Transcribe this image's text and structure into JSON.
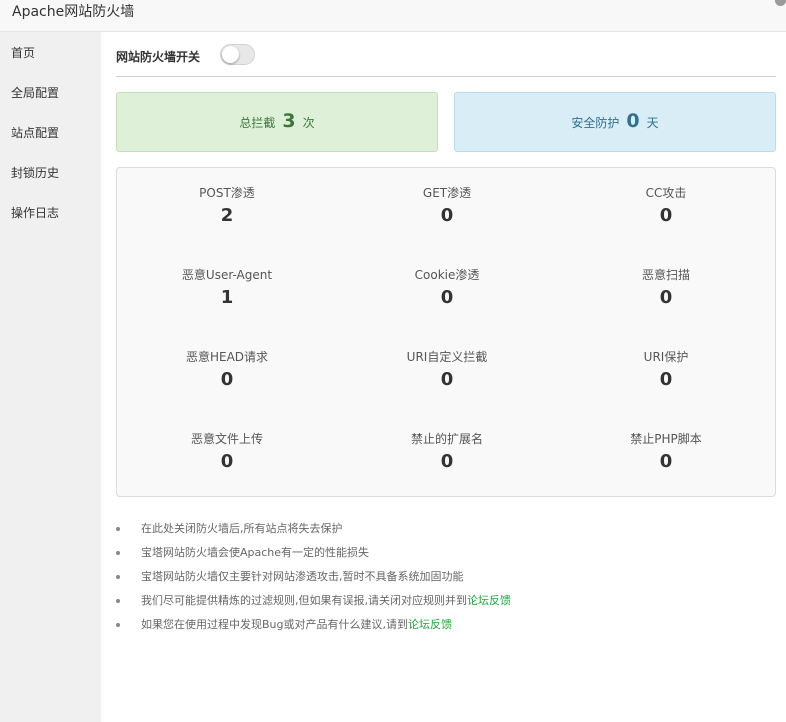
{
  "window": {
    "title": "Apache网站防火墙"
  },
  "sidebar": {
    "items": [
      {
        "label": "首页"
      },
      {
        "label": "全局配置"
      },
      {
        "label": "站点配置"
      },
      {
        "label": "封锁历史"
      },
      {
        "label": "操作日志"
      }
    ]
  },
  "switch": {
    "label": "网站防火墙开关",
    "enabled": false
  },
  "summary": {
    "total_intercept": {
      "label": "总拦截",
      "value": "3",
      "unit": "次"
    },
    "safe_protect": {
      "label": "安全防护",
      "value": "0",
      "unit": "天"
    }
  },
  "stats": [
    {
      "label": "POST渗透",
      "value": "2"
    },
    {
      "label": "GET渗透",
      "value": "0"
    },
    {
      "label": "CC攻击",
      "value": "0"
    },
    {
      "label": "恶意User-Agent",
      "value": "1"
    },
    {
      "label": "Cookie渗透",
      "value": "0"
    },
    {
      "label": "恶意扫描",
      "value": "0"
    },
    {
      "label": "恶意HEAD请求",
      "value": "0"
    },
    {
      "label": "URI自定义拦截",
      "value": "0"
    },
    {
      "label": "URI保护",
      "value": "0"
    },
    {
      "label": "恶意文件上传",
      "value": "0"
    },
    {
      "label": "禁止的扩展名",
      "value": "0"
    },
    {
      "label": "禁止PHP脚本",
      "value": "0"
    }
  ],
  "notes": [
    {
      "text": "在此处关闭防火墙后,所有站点将失去保护"
    },
    {
      "text": "宝塔网站防火墙会使Apache有一定的性能损失"
    },
    {
      "text": "宝塔网站防火墙仅主要针对网站渗透攻击,暂时不具备系统加固功能"
    },
    {
      "text": "我们尽可能提供精炼的过滤规则,但如果有误报,请关闭对应规则并到",
      "link": "论坛反馈"
    },
    {
      "text": "如果您在使用过程中发现Bug或对产品有什么建议,请到",
      "link": "论坛反馈"
    }
  ],
  "colors": {
    "accent_link": "#20a53a",
    "success_bg": "#dff0d8",
    "info_bg": "#d9edf7"
  }
}
